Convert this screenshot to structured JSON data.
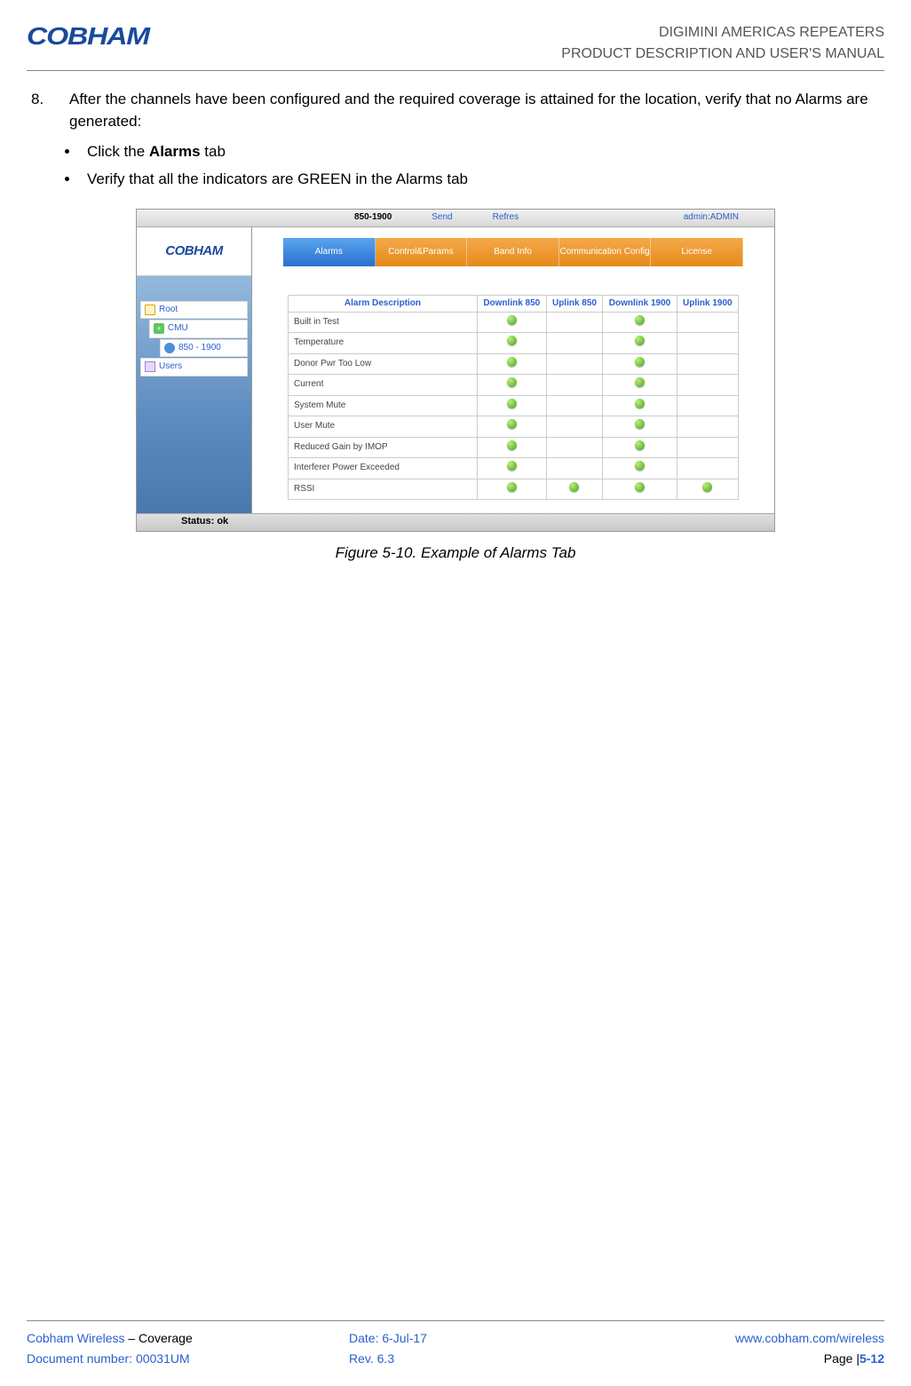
{
  "header": {
    "logo_text": "COBHAM",
    "title1": "DIGIMINI AMERICAS REPEATERS",
    "title2": "PRODUCT DESCRIPTION AND USER'S MANUAL"
  },
  "body": {
    "step_number": "8.",
    "step_text": "After the channels have been configured and the required coverage is attained for the location, verify that no Alarms are generated:",
    "bullet1_pre": "Click the ",
    "bullet1_bold": "Alarms",
    "bullet1_post": " tab",
    "bullet2": "Verify that all the indicators are GREEN in the Alarms tab"
  },
  "screenshot": {
    "topbar": {
      "device": "850-1900",
      "send": "Send",
      "refresh": "Refres",
      "admin": "admin:ADMIN"
    },
    "logo": "COBHAM",
    "tree": {
      "root": "Root",
      "cmu": "CMU",
      "band": "850 - 1900",
      "users": "Users"
    },
    "tabs": {
      "alarms": "Alarms",
      "control": "Control&Params",
      "band": "Band Info",
      "comm": "Communication Config",
      "license": "License"
    },
    "table": {
      "h_desc": "Alarm Description",
      "h_dl850": "Downlink 850",
      "h_ul850": "Uplink 850",
      "h_dl1900": "Downlink 1900",
      "h_ul1900": "Uplink 1900",
      "rows": {
        "r1": "Built in Test",
        "r2": "Temperature",
        "r3": "Donor Pwr Too Low",
        "r4": "Current",
        "r5": "System Mute",
        "r6": "User Mute",
        "r7": "Reduced Gain by IMOP",
        "r8": "Interferer Power Exceeded",
        "r9": "RSSI"
      }
    },
    "status": "Status: ok"
  },
  "caption": "Figure 5-10. Example of Alarms Tab",
  "footer": {
    "l1a": "Cobham Wireless",
    "l1b": " – Coverage",
    "l2": "Document number: 00031UM",
    "c1": "Date: 6-Jul-17",
    "c2": "Rev. 6.3",
    "r1": "www.cobham.com/wireless",
    "r2a": "Page |",
    "r2b": "5-12"
  }
}
